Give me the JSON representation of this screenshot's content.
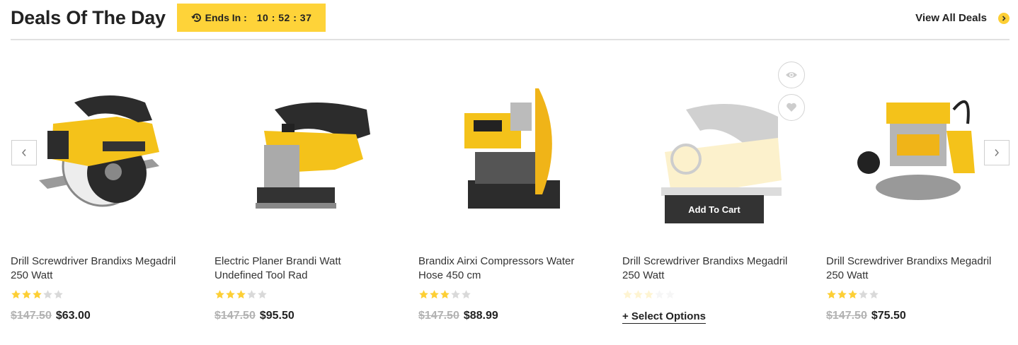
{
  "section": {
    "title": "Deals Of The Day",
    "countdown_label": "Ends In :",
    "countdown_time": "10 : 52 : 37",
    "view_all_label": "View All Deals"
  },
  "colors": {
    "accent": "#fed339",
    "dark_button": "#333333",
    "old_price": "#b3b3b3",
    "star_filled": "#fdcf35",
    "star_empty": "#d9d9d9"
  },
  "products": [
    {
      "name": "Drill Screwdriver Brandixs Megadril 250 Watt",
      "rating": 3,
      "old_price": "$147.50",
      "price": "$63.00",
      "image": "circular-saw"
    },
    {
      "name": "Electric Planer Brandi Watt Undefined Tool Rad",
      "rating": 3,
      "old_price": "$147.50",
      "price": "$95.50",
      "image": "jigsaw"
    },
    {
      "name": "Brandix Airxi Compressors Water Hose 450 cm",
      "rating": 3,
      "old_price": "$147.50",
      "price": "$88.99",
      "image": "chop-saw"
    },
    {
      "name": "Drill Screwdriver Brandixs Megadril 250 Watt",
      "rating": 3,
      "action_label": "+ Select Options",
      "hover_button": "Add To Cart",
      "image": "planer"
    },
    {
      "name": "Drill Screwdriver Brandixs Megadril 250 Watt",
      "rating": 3,
      "old_price": "$147.50",
      "price": "$75.50",
      "image": "router"
    }
  ]
}
